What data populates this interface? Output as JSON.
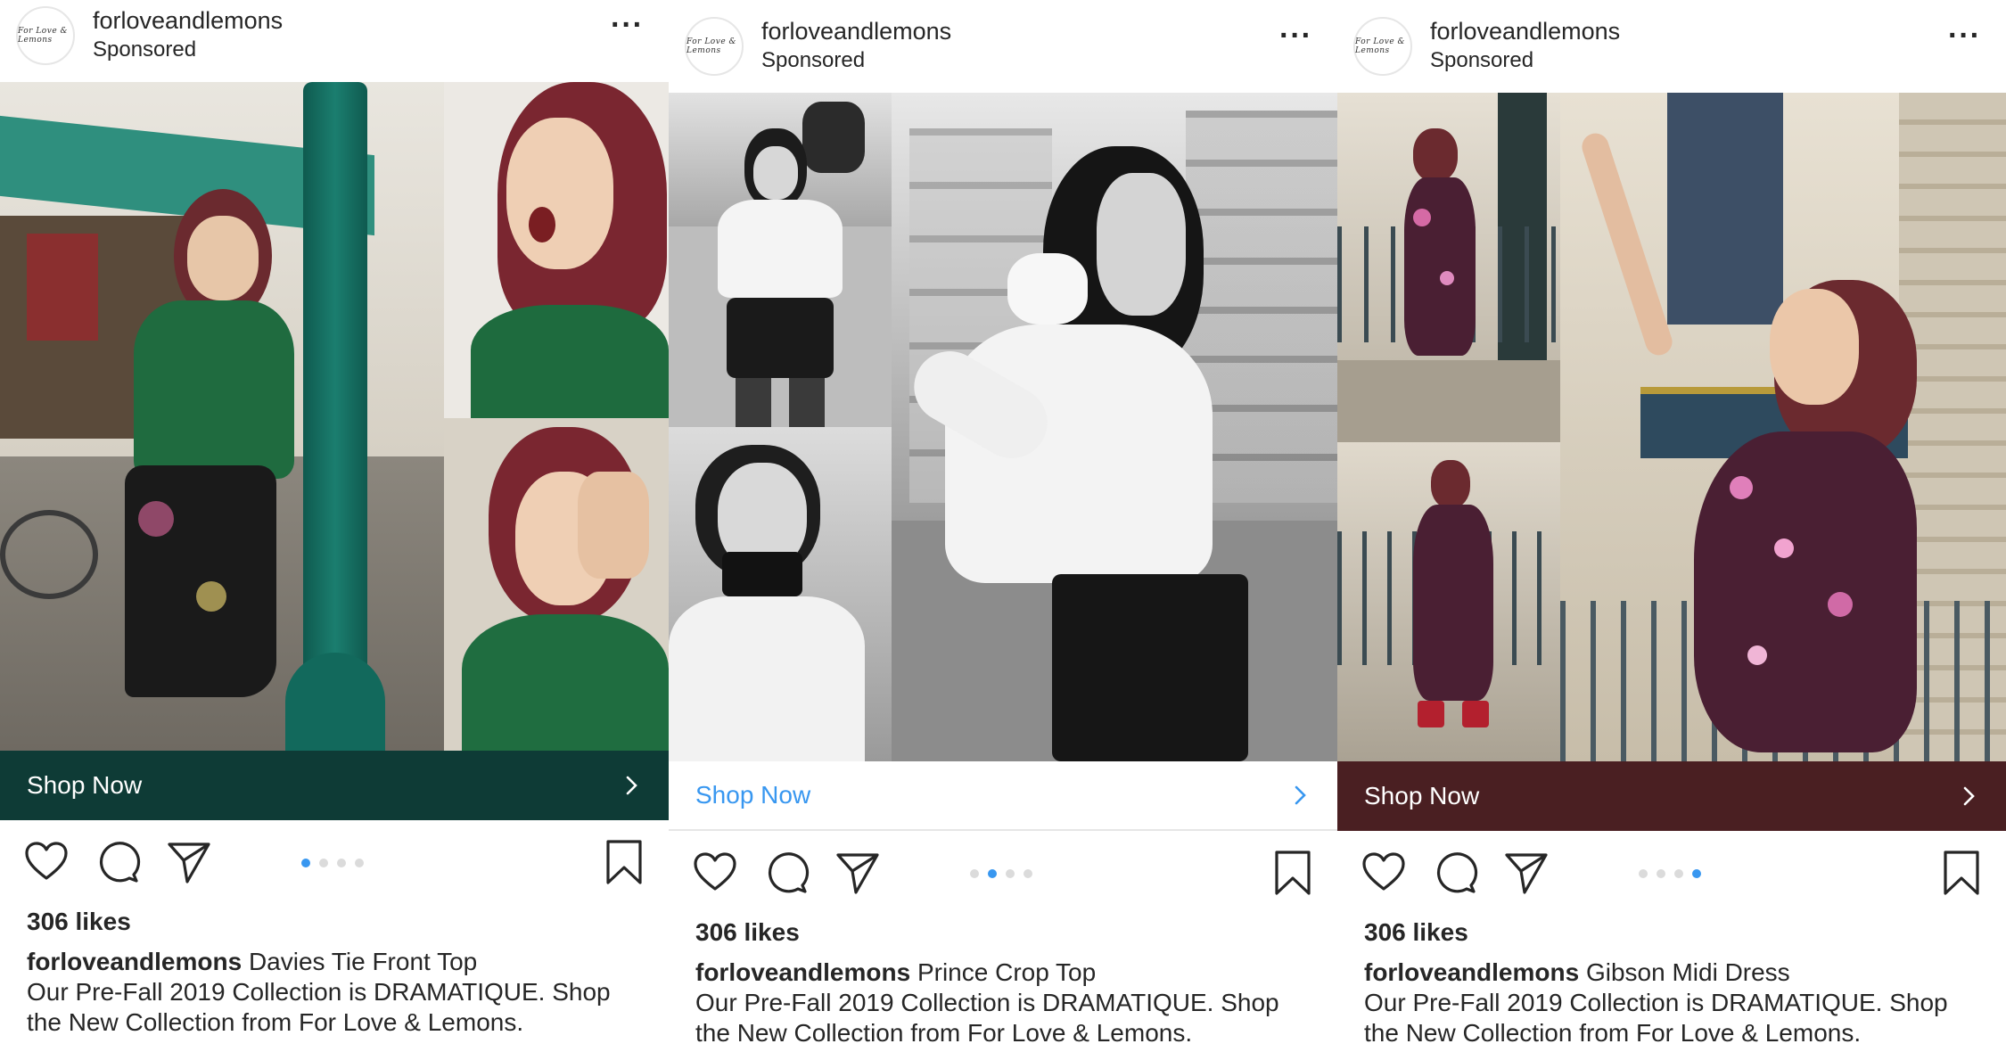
{
  "posts": [
    {
      "username": "forloveandlemons",
      "sponsored": "Sponsored",
      "avatar_text": "For Love & Lemons",
      "more_icon": "more-horizontal-icon",
      "cta_label": "Shop Now",
      "cta_style": {
        "background": "#0e3b36",
        "text": "#ffffff"
      },
      "carousel": {
        "count": 4,
        "active_index": 0
      },
      "likes": "306 likes",
      "caption_user": "forloveandlemons",
      "caption_title": " Davies Tie Front Top",
      "caption_body": "Our Pre-Fall 2019 Collection is DRAMATIQUE. Shop the New Collection from For Love & Lemons."
    },
    {
      "username": "forloveandlemons",
      "sponsored": "Sponsored",
      "avatar_text": "For Love & Lemons",
      "more_icon": "more-horizontal-icon",
      "cta_label": "Shop Now",
      "cta_style": {
        "background": "#ffffff",
        "text": "#3897f0"
      },
      "carousel": {
        "count": 4,
        "active_index": 1
      },
      "likes": "306 likes",
      "caption_user": "forloveandlemons",
      "caption_title": " Prince Crop Top",
      "caption_body": "Our Pre-Fall 2019 Collection is DRAMATIQUE. Shop the New Collection from For Love & Lemons."
    },
    {
      "username": "forloveandlemons",
      "sponsored": "Sponsored",
      "avatar_text": "For Love & Lemons",
      "more_icon": "more-horizontal-icon",
      "cta_label": "Shop Now",
      "cta_style": {
        "background": "#4a1f22",
        "text": "#ffffff"
      },
      "carousel": {
        "count": 4,
        "active_index": 3
      },
      "likes": "306 likes",
      "caption_user": "forloveandlemons",
      "caption_title": " Gibson Midi Dress",
      "caption_body": "Our Pre-Fall 2019 Collection is DRAMATIQUE. Shop the New Collection from For Love & Lemons."
    }
  ],
  "icons": {
    "like": "heart-icon",
    "comment": "comment-icon",
    "share": "paper-plane-icon",
    "save": "bookmark-icon",
    "cta_arrow": "chevron-right-icon"
  }
}
